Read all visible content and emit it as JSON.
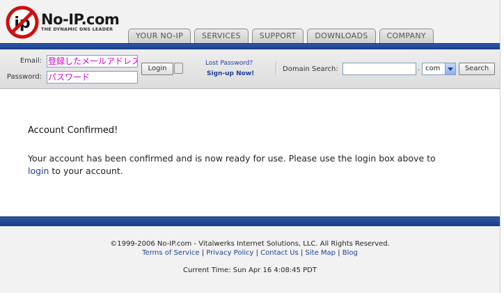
{
  "brand": {
    "name": "No-IP.com",
    "tagline": "THE DYNAMIC DNS LEADER",
    "logo_text": "ip"
  },
  "nav": {
    "tabs": [
      "YOUR NO-IP",
      "SERVICES",
      "SUPPORT",
      "DOWNLOADS",
      "COMPANY"
    ]
  },
  "login": {
    "email_label": "Email:",
    "password_label": "Password:",
    "email_value": "登録したメールアドレス",
    "password_value": "パスワード",
    "login_button": "Login",
    "lost_password": "Lost Password?",
    "signup": "Sign-up Now!"
  },
  "domain_search": {
    "label": "Domain Search:",
    "dot": ".",
    "tld": "com",
    "search_button": "Search"
  },
  "main": {
    "title": "Account Confirmed!",
    "body_before": "Your account has been confirmed and is now ready for use. Please use the login box above to",
    "body_link": "login",
    "body_after": " to your account."
  },
  "footer": {
    "copyright": "©1999-2006 No-IP.com - Vitalwerks Internet Solutions, LLC. All Rights Reserved.",
    "links": [
      "Terms of Service",
      "Privacy Policy",
      "Contact Us",
      "Site Map",
      "Blog"
    ],
    "separator": " | ",
    "current_time": "Current Time: Sun Apr 16 4:08:45 PDT"
  },
  "colors": {
    "nav_stripe": "#1f4a9a",
    "link": "#1d3f9c",
    "logo_red": "#cc1111",
    "input_text": "#cc00cc"
  },
  "icons": [
    "no-ip-logo",
    "lock-icon",
    "dropdown-arrow-icon"
  ]
}
